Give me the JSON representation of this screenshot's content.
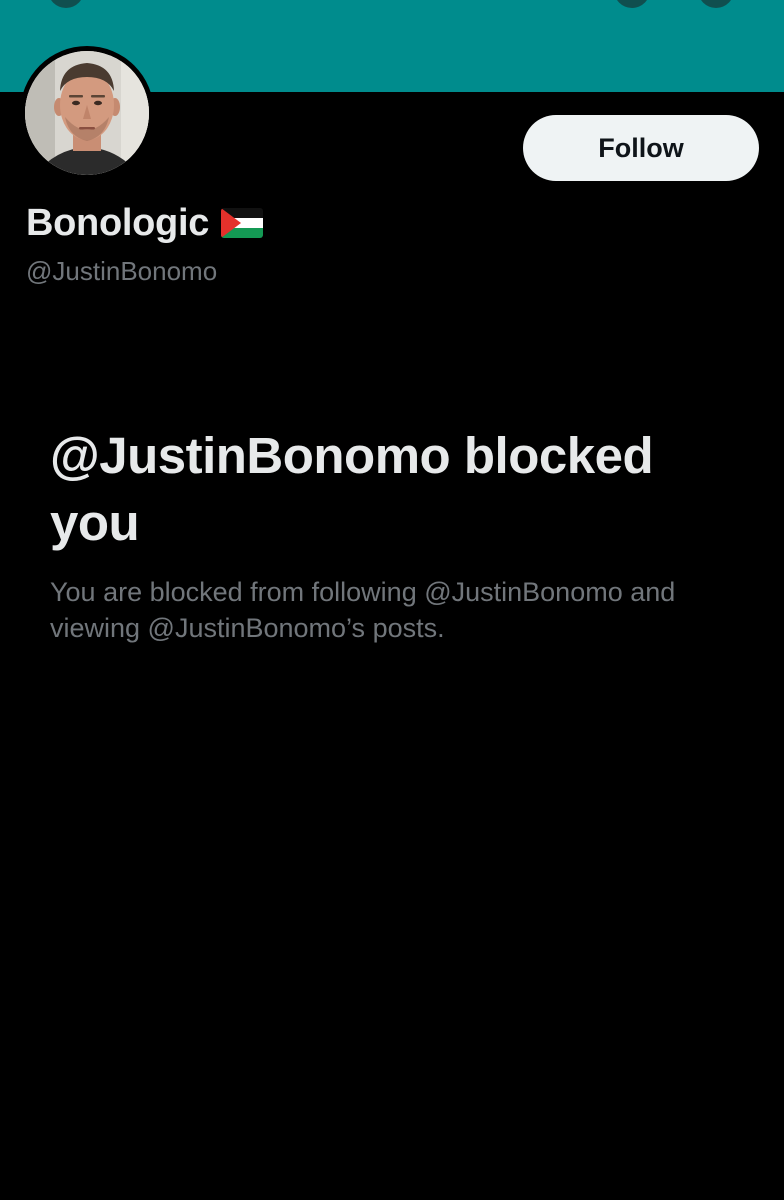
{
  "profile": {
    "display_name": "Bonologic",
    "flag_icon": "palestine-flag-icon",
    "handle": "@JustinBonomo",
    "follow_label": "Follow",
    "banner_color": "#008c8d"
  },
  "blocked": {
    "title": "@JustinBonomo blocked you",
    "description": "You are blocked from following @JustinBonomo and viewing @JustinBonomo’s posts."
  },
  "colors": {
    "background": "#000000",
    "primary_text": "#e7e9ea",
    "secondary_text": "#71767b",
    "button_bg": "#eff3f4",
    "button_text": "#0f1419"
  }
}
